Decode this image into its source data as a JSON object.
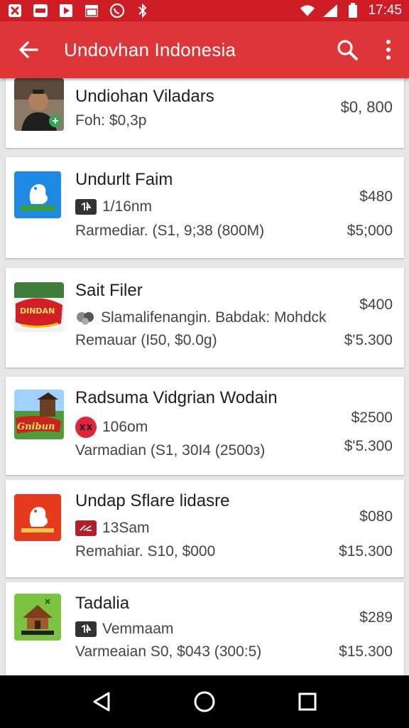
{
  "status_bar": {
    "time": "17:45",
    "icons": [
      "notification-square-icon",
      "message-icon",
      "play-icon",
      "calendar-icon",
      "whatsapp-icon",
      "bluetooth-icon",
      "wifi-icon",
      "signal-icon",
      "battery-icon"
    ]
  },
  "app_bar": {
    "title": "Undovhan Indonesia",
    "back_icon": "arrow-back-icon",
    "search_icon": "search-icon",
    "menu_icon": "more-vert-icon"
  },
  "items": [
    {
      "name": "Undiohan Viladars",
      "line1": "Foh: $0,3p",
      "price1": "$0, 800",
      "line2": "",
      "price2": ""
    },
    {
      "name": "Undurlt Faim",
      "line1": "1/16nm",
      "badge": "ɪ4",
      "price1": "$480",
      "line2": "Rarmediar. (S1, 9;38  (800M)",
      "price2": "$5;000"
    },
    {
      "name": "Sait Filer",
      "line1": "Slamalifenangin. Babdak: Mohdck",
      "thumb_text": "DINDAN",
      "price1": "$400",
      "line2": "Remauar  (I50, $0.0g)",
      "price2": "$'5.300"
    },
    {
      "name": "Radsuma Vidgrian Wodain",
      "line1": "106om",
      "thumb_text": "Gnibun",
      "price1": "$2500",
      "line2": "Varmadian  (S1, 30I4  (2500з)",
      "price2": "$'5.300"
    },
    {
      "name": "Undap Sflare lidasre",
      "line1": "13Sam",
      "price1": "$080",
      "line2": "Remahiar. S10, $000",
      "price2": "$15.300"
    },
    {
      "name": "Tadalia",
      "line1": "Vemmaam",
      "badge": "ɪ4",
      "price1": "$289",
      "line2": "Varmeaian  S0, $043  (300:5)",
      "price2": "$15.300"
    }
  ],
  "nav_bar": {
    "back_icon": "nav-back-icon",
    "home_icon": "nav-home-icon",
    "recents_icon": "nav-recents-icon"
  }
}
